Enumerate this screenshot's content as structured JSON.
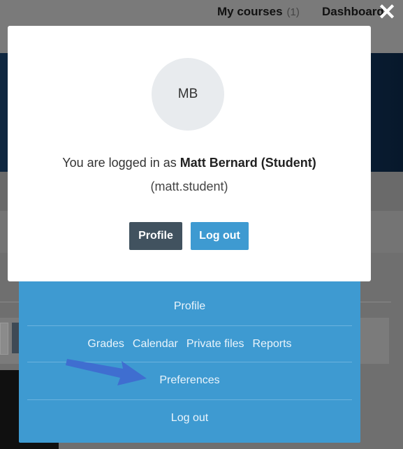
{
  "header": {
    "my_courses_label": "My courses",
    "my_courses_count": "(1)",
    "dashboard_label": "Dashboard",
    "close_glyph": "✕"
  },
  "modal": {
    "avatar_initials": "MB",
    "logged_in_prefix": "You are logged in as ",
    "user_display": "Matt Bernard (Student)",
    "username": "(matt.student)",
    "profile_button": "Profile",
    "logout_button": "Log out"
  },
  "menu": {
    "profile": "Profile",
    "links": [
      "Grades",
      "Calendar",
      "Private files",
      "Reports"
    ],
    "preferences": "Preferences",
    "logout": "Log out"
  },
  "colors": {
    "menu_bg": "#3e9ad1",
    "profile_button": "#41525f",
    "logout_button": "#3e9ad1",
    "arrow": "#3f6ed0"
  },
  "icons": {
    "close": "close-icon",
    "arrow": "arrow-right-icon"
  }
}
